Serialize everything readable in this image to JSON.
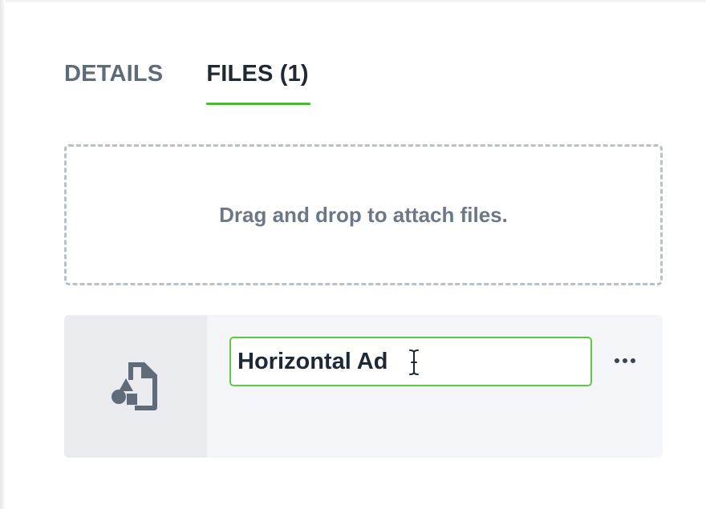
{
  "tabs": [
    {
      "label": "DETAILS",
      "active": false
    },
    {
      "label": "FILES (1)",
      "active": true
    }
  ],
  "dropzone": {
    "text": "Drag and drop to attach files."
  },
  "files": [
    {
      "name_value": "Horizontal Ad",
      "thumb_icon": "file-shapes-icon",
      "menu_icon": "more-horizontal-icon"
    }
  ],
  "colors": {
    "accent": "#3ec31f",
    "input_border": "#5bc943",
    "text_dark": "#1f2933",
    "text_muted": "#5f6b78"
  }
}
